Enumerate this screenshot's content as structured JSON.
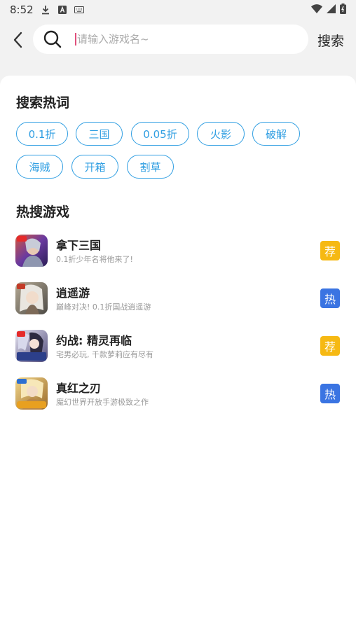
{
  "status_bar": {
    "time": "8:52",
    "left_icons": [
      "download-icon",
      "a-square-icon",
      "keyboard-icon"
    ],
    "right_icons": [
      "wifi-icon",
      "signal-icon",
      "battery-icon"
    ]
  },
  "header": {
    "search_placeholder": "请输入游戏名~",
    "search_button": "搜索"
  },
  "hot_words": {
    "title": "搜索热词",
    "tags": [
      "0.1折",
      "三国",
      "0.05折",
      "火影",
      "破解",
      "海贼",
      "开箱",
      "割草"
    ]
  },
  "hot_games": {
    "title": "热搜游戏",
    "items": [
      {
        "name": "拿下三国",
        "desc": "0.1折少年名将他来了!",
        "badge": "荐",
        "badge_color": "#f6b913"
      },
      {
        "name": "逍遥游",
        "desc": "巅峰对决! 0.1折国战逍遥游",
        "badge": "热",
        "badge_color": "#3a74e2"
      },
      {
        "name": "约战: 精灵再临",
        "desc": "宅男必玩, 千款萝莉应有尽有",
        "badge": "荐",
        "badge_color": "#f6b913"
      },
      {
        "name": "真红之刃",
        "desc": "魔幻世界开放手游极致之作",
        "badge": "热",
        "badge_color": "#3a74e2"
      }
    ]
  },
  "colors": {
    "accent": "#2f9ee2",
    "background": "#f2f2f2",
    "panel": "#ffffff"
  }
}
